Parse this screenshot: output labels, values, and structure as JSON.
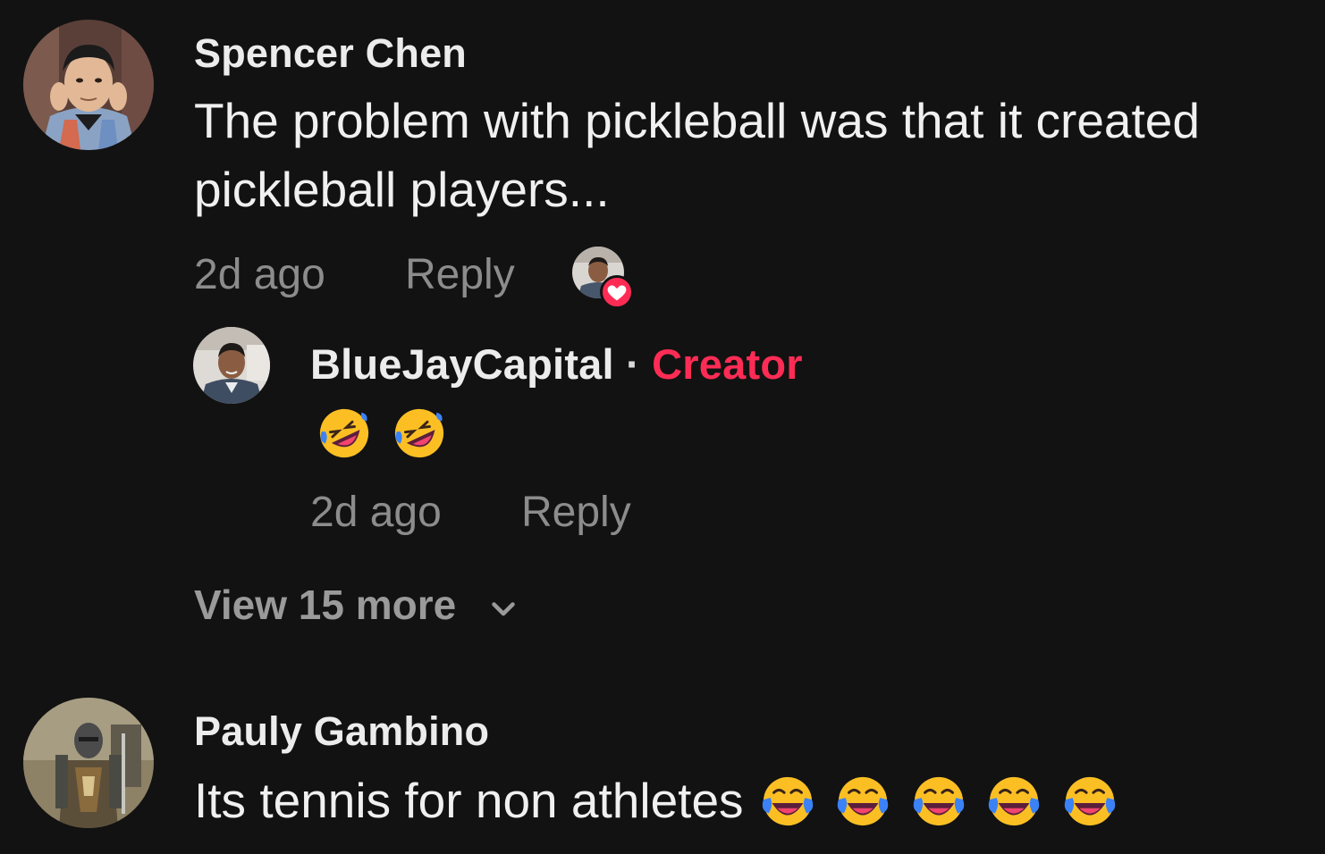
{
  "comments": [
    {
      "username": "Spencer Chen",
      "text_line1": "The problem with pickleball was that it created",
      "text_line2": "pickleball players...",
      "time": "2d ago",
      "reply_label": "Reply",
      "avatar_icon": "user-avatar-photo",
      "liked_by_creator_icon": "heart-icon"
    },
    {
      "username": "Pauly Gambino",
      "text": "Its tennis for non athletes",
      "avatar_icon": "knight-avatar-photo",
      "emoji_icon": "face-with-tears-of-joy-emoji"
    }
  ],
  "reply": {
    "username": "BlueJayCapital",
    "separator": "·",
    "badge": "Creator",
    "emoji_icon": "rolling-on-the-floor-laughing-emoji",
    "time": "2d ago",
    "reply_label": "Reply"
  },
  "view_more": {
    "label": "View 15 more",
    "icon": "chevron-down-icon"
  },
  "colors": {
    "background": "#121212",
    "creator_badge": "#fe2c55",
    "meta_text": "#8c8c8c"
  }
}
